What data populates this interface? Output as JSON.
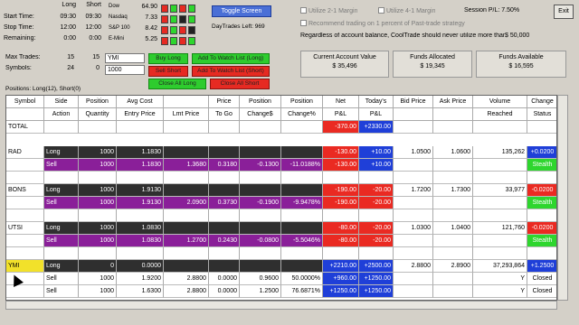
{
  "stats": {
    "col_long": "Long",
    "col_short": "Short",
    "rows": [
      {
        "label": "Start Time:",
        "long": "09:30",
        "short": "09:30"
      },
      {
        "label": "Stop Time:",
        "long": "12:00",
        "short": "12:00"
      },
      {
        "label": "Remaining:",
        "long": "0:00",
        "short": "0:00"
      }
    ]
  },
  "indices": [
    {
      "name": "Dow",
      "value": "64.90"
    },
    {
      "name": "Nasdaq",
      "value": "7.33"
    },
    {
      "name": "S&P 100",
      "value": "8.42"
    },
    {
      "name": "E-Mini",
      "value": "5.25"
    }
  ],
  "toggle_label": "Toggle Screen",
  "day_trades": "DayTrades Left: 969",
  "checks": {
    "utilize_2x": "Utilize 2-1 Margin",
    "utilize_4x": "Utilize 4-1 Margin",
    "session_pl": "Session P/L: 7.50%",
    "recommend": "Recommend trading on 1 percent of Past-trade strategy"
  },
  "regardless_text": "Regardless of account balance, CoolTrade should never utilize more than",
  "regardless_value": "$ 50,000",
  "exit_label": "Exit",
  "max_trades": {
    "label": "Max Trades:",
    "long": "15",
    "short": "15"
  },
  "symbols": {
    "label": "Symbols:",
    "long": "24",
    "short": "0"
  },
  "symbol_input": "YMI",
  "qty_input": "1000",
  "buttons": {
    "buy_long": "Buy Long",
    "add_watch": "Add To Watch List (Long)",
    "sell_short": "Sell Short",
    "add_watch_short": "Add To Watch List (Short)",
    "close_all_long": "Close All Long",
    "close_all_short": "Close All Short"
  },
  "account": [
    {
      "label": "Current Account Value",
      "value": "$ 35,496"
    },
    {
      "label": "Funds Allocated",
      "value": "$ 19,345"
    },
    {
      "label": "Funds Available",
      "value": "$ 16,595"
    }
  ],
  "positions_label": "Positions: Long(12), Short(0)",
  "headers": {
    "row1": [
      "Symbol",
      "Side",
      "Position",
      "Avg Cost",
      "",
      "Price",
      "Position",
      "Position",
      "Net",
      "Today's",
      "Bid Price",
      "Ask Price",
      "Volume",
      "Change"
    ],
    "row2": [
      "",
      "Action",
      "Quantity",
      "Entry Price",
      "Lmt Price",
      "To Go",
      "Change$",
      "Change%",
      "P&L",
      "P&L",
      "",
      "",
      "Reached",
      "Status"
    ]
  },
  "total": {
    "symbol": "TOTAL",
    "net": "-370.00",
    "today": "+2330.00"
  },
  "rows": [
    {
      "sym": "RAD",
      "side": "Long",
      "qty": "1000",
      "cost": "1.1830",
      "lmt": "",
      "togo": "",
      "chg": "",
      "chgp": "",
      "net": "-130.00",
      "today": "+10.00",
      "bid": "1.0500",
      "ask": "1.0600",
      "vol": "135,262",
      "cs": "+0.0200",
      "kind": "long"
    },
    {
      "sym": "",
      "side": "Sell",
      "qty": "1000",
      "cost": "1.1830",
      "lmt": "1.3680",
      "togo": "0.3180",
      "chg": "-0.1300",
      "chgp": "-11.0188%",
      "net": "-130.00",
      "today": "+10.00",
      "bid": "",
      "ask": "",
      "vol": "",
      "cs": "Stealth",
      "kind": "sell"
    },
    {
      "sym": "",
      "side": "",
      "qty": "",
      "cost": "",
      "lmt": "",
      "togo": "",
      "chg": "",
      "chgp": "",
      "net": "",
      "today": "",
      "bid": "",
      "ask": "",
      "vol": "",
      "cs": "",
      "kind": "blank"
    },
    {
      "sym": "BONS",
      "side": "Long",
      "qty": "1000",
      "cost": "1.9130",
      "lmt": "",
      "togo": "",
      "chg": "",
      "chgp": "",
      "net": "-190.00",
      "today": "-20.00",
      "bid": "1.7200",
      "ask": "1.7300",
      "vol": "33,977",
      "cs": "-0.0200",
      "kind": "long"
    },
    {
      "sym": "",
      "side": "Sell",
      "qty": "1000",
      "cost": "1.9130",
      "lmt": "2.0900",
      "togo": "0.3730",
      "chg": "-0.1900",
      "chgp": "-9.9478%",
      "net": "-190.00",
      "today": "-20.00",
      "bid": "",
      "ask": "",
      "vol": "",
      "cs": "Stealth",
      "kind": "sell"
    },
    {
      "sym": "",
      "side": "",
      "qty": "",
      "cost": "",
      "lmt": "",
      "togo": "",
      "chg": "",
      "chgp": "",
      "net": "",
      "today": "",
      "bid": "",
      "ask": "",
      "vol": "",
      "cs": "",
      "kind": "blank"
    },
    {
      "sym": "UTSI",
      "side": "Long",
      "qty": "1000",
      "cost": "1.0830",
      "lmt": "",
      "togo": "",
      "chg": "",
      "chgp": "",
      "net": "-80.00",
      "today": "-20.00",
      "bid": "1.0300",
      "ask": "1.0400",
      "vol": "121,760",
      "cs": "-0.0200",
      "kind": "long"
    },
    {
      "sym": "",
      "side": "Sell",
      "qty": "1000",
      "cost": "1.0830",
      "lmt": "1.2700",
      "togo": "0.2430",
      "chg": "-0.0800",
      "chgp": "-5.5046%",
      "net": "-80.00",
      "today": "-20.00",
      "bid": "",
      "ask": "",
      "vol": "",
      "cs": "Stealth",
      "kind": "sell"
    },
    {
      "sym": "",
      "side": "",
      "qty": "",
      "cost": "",
      "lmt": "",
      "togo": "",
      "chg": "",
      "chgp": "",
      "net": "",
      "today": "",
      "bid": "",
      "ask": "",
      "vol": "",
      "cs": "",
      "kind": "blank"
    },
    {
      "sym": "YMI",
      "side": "Long",
      "qty": "0",
      "cost": "0.0000",
      "lmt": "",
      "togo": "",
      "chg": "",
      "chgp": "",
      "net": "+2210.00",
      "today": "+2500.00",
      "bid": "2.8800",
      "ask": "2.8900",
      "vol": "37,293,864",
      "cs": "+1.2500",
      "kind": "ymi"
    },
    {
      "sym": "",
      "side": "Sell",
      "qty": "1000",
      "cost": "1.9200",
      "lmt": "2.8800",
      "togo": "0.0000",
      "chg": "0.9600",
      "chgp": "50.0000%",
      "net": "+960.00",
      "today": "+1250.00",
      "bid": "",
      "ask": "",
      "vol": "Y",
      "cs": "Closed",
      "kind": "closed"
    },
    {
      "sym": "",
      "side": "Sell",
      "qty": "1000",
      "cost": "1.6300",
      "lmt": "2.8800",
      "togo": "0.0000",
      "chg": "1.2500",
      "chgp": "76.6871%",
      "net": "+1250.00",
      "today": "+1250.00",
      "bid": "",
      "ask": "",
      "vol": "Y",
      "cs": "Closed",
      "kind": "closed"
    }
  ]
}
